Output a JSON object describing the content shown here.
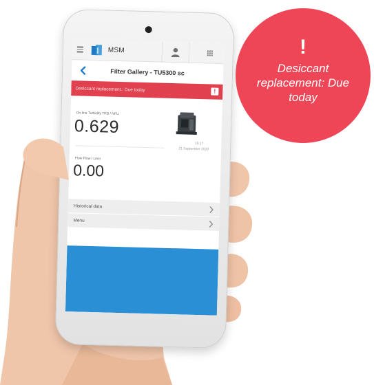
{
  "app": {
    "name": "MSM"
  },
  "header": {
    "icons": [
      "menu-icon",
      "msm-logo-icon",
      "user-avatar-icon",
      "grid-menu-icon"
    ]
  },
  "page": {
    "title": "Filter Gallery - TU5300 sc",
    "back_icon": "chevron-left-icon"
  },
  "alert": {
    "text": "Desiccant replacement.: Due today",
    "badge": "!",
    "color": "#e1404f"
  },
  "measurement": {
    "primary_label": "On-line Turbidity TRB / NFU",
    "primary_value": "0.629",
    "time": "15:17",
    "date": "21 September 2020",
    "secondary_label": "Flow Flow / Lmin",
    "secondary_value": "0.00"
  },
  "list": [
    {
      "label": "Historical data",
      "icon": "chevron-right-icon"
    },
    {
      "label": "Menu",
      "icon": "chevron-right-icon"
    }
  ],
  "callout": {
    "mark": "!",
    "text": "Desiccant replacement: Due today",
    "color": "#ee4657"
  },
  "colors": {
    "accent_blue": "#2b8fd6",
    "logo_blue": "#1f79c4"
  }
}
